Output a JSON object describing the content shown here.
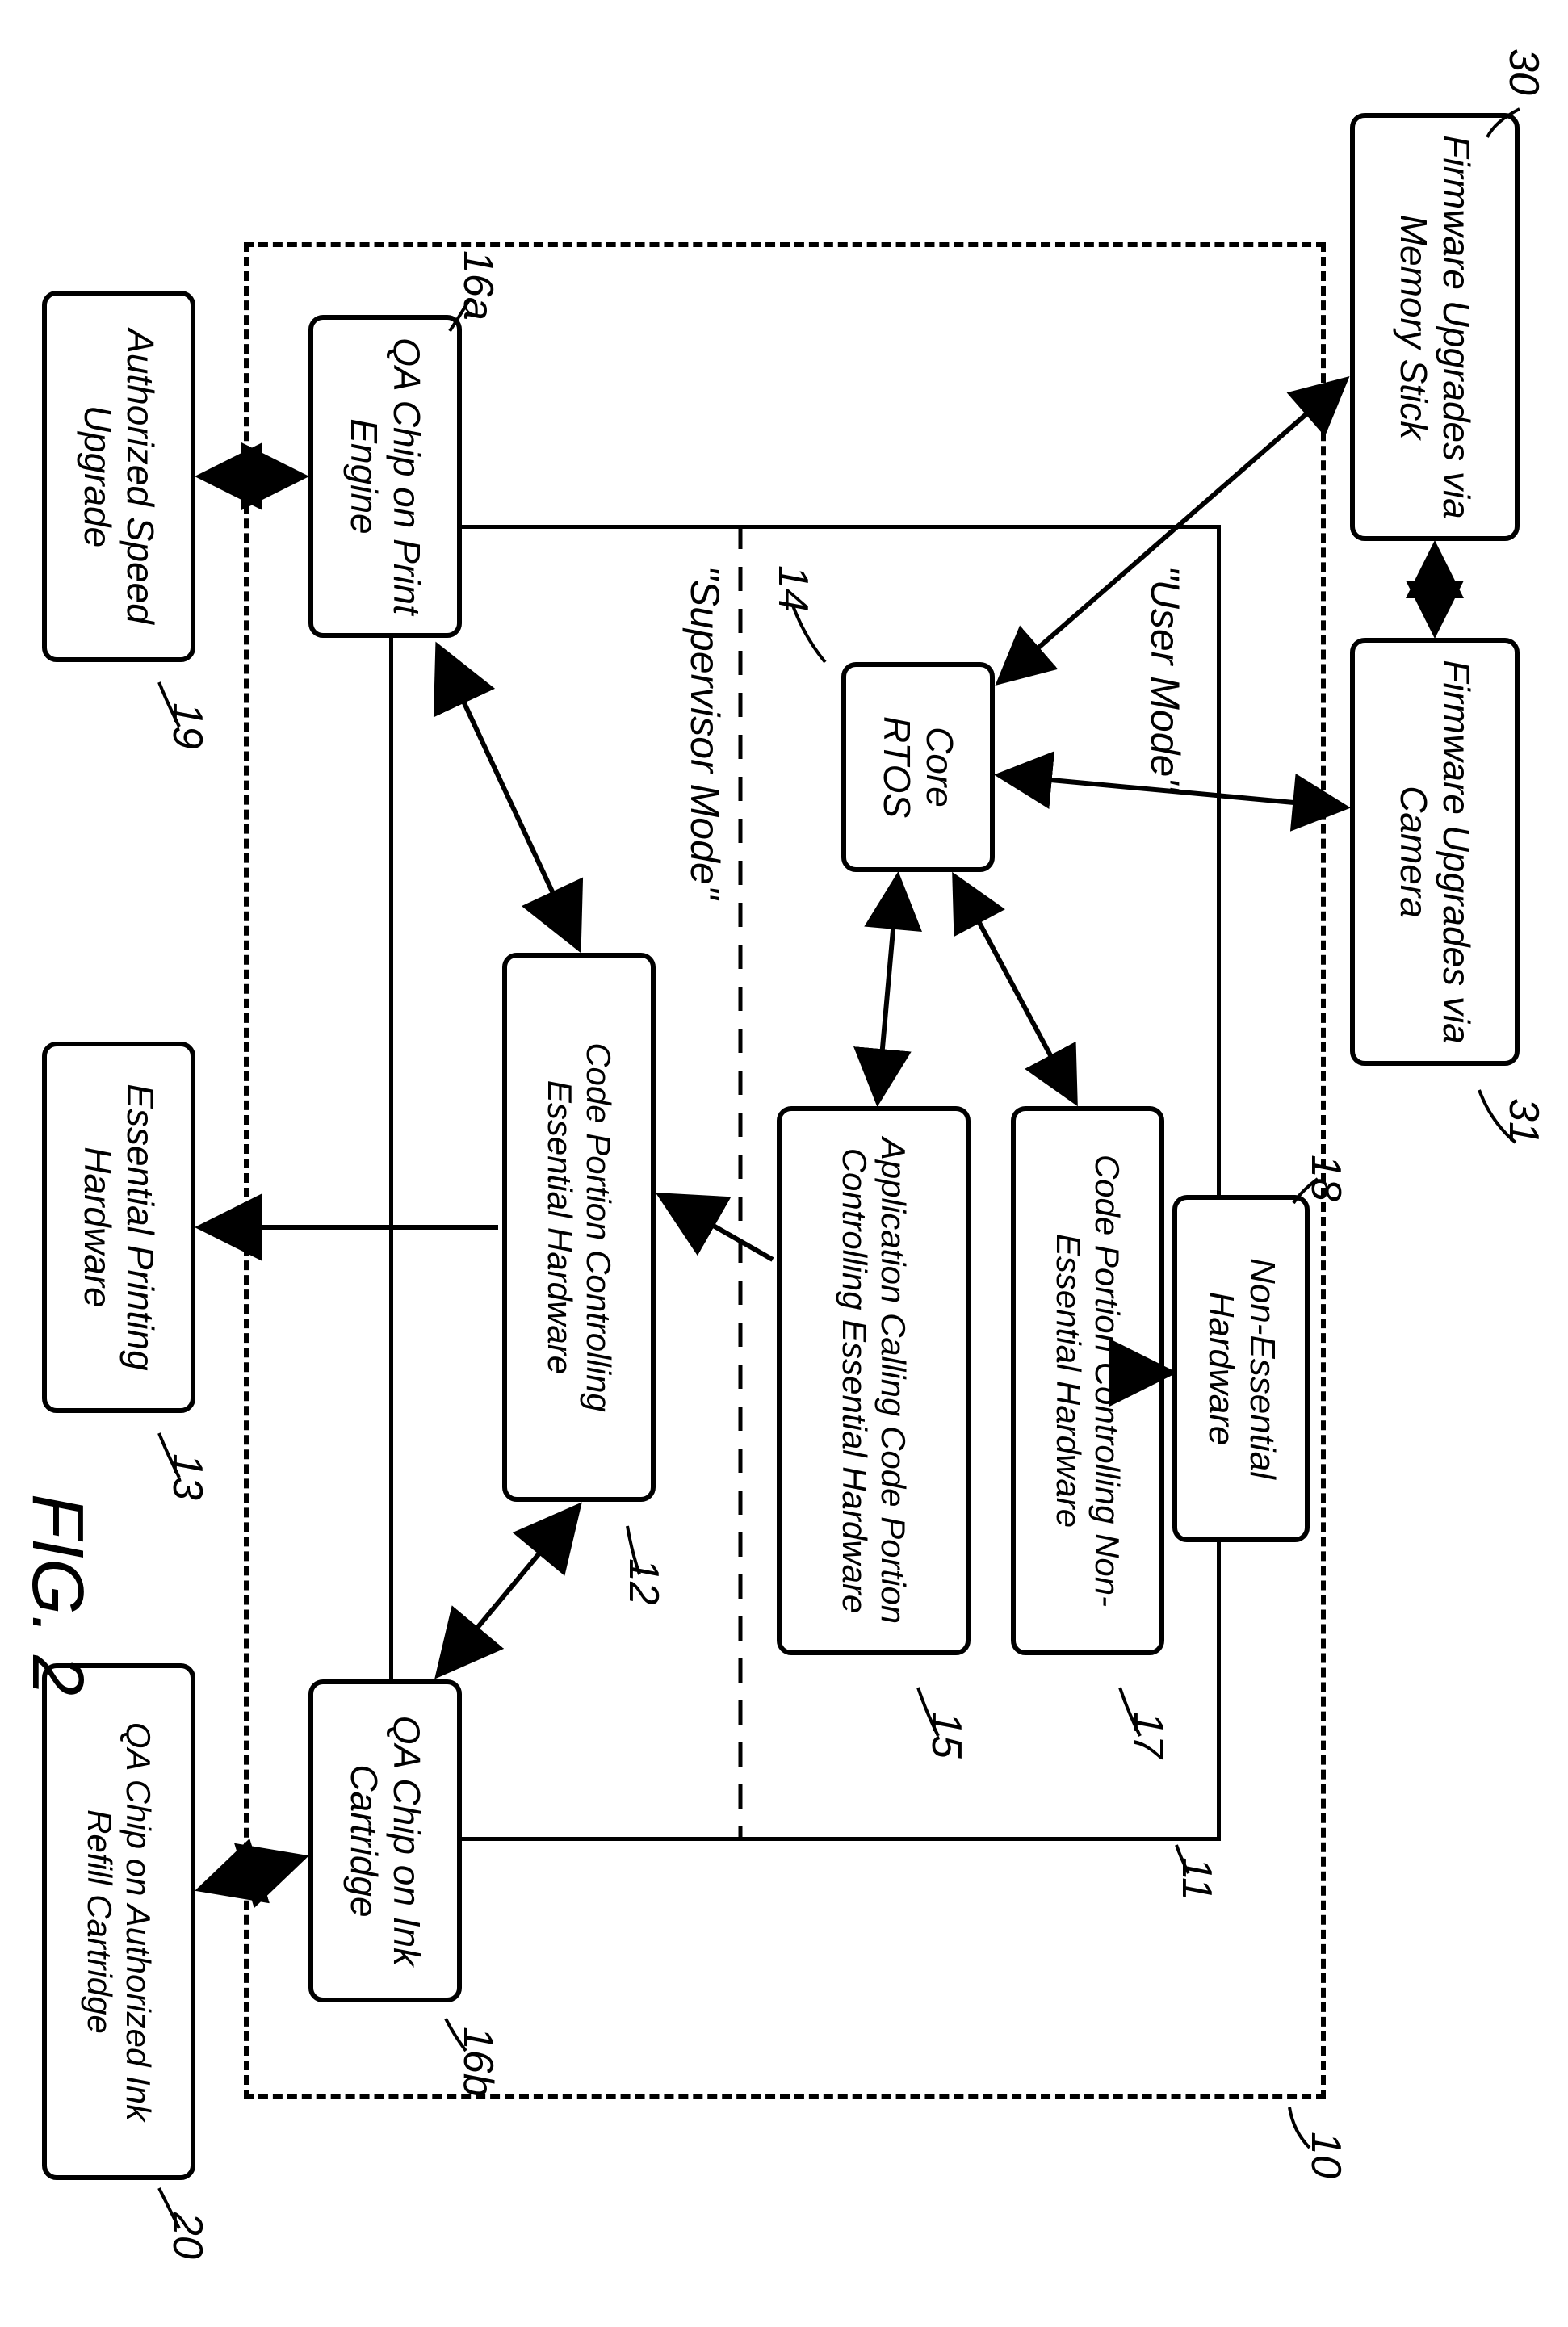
{
  "figure_label": "FIG. 2",
  "refs": {
    "r10": "10",
    "r11": "11",
    "r12": "12",
    "r13": "13",
    "r14": "14",
    "r15": "15",
    "r16a": "16a",
    "r16b": "16b",
    "r17": "17",
    "r18": "18",
    "r19": "19",
    "r20": "20",
    "r30": "30",
    "r31": "31"
  },
  "mode_labels": {
    "user": "\"User Mode\"",
    "supervisor": "\"Supervisor Mode\""
  },
  "boxes": {
    "firmware_mem": "Firmware Upgrades via Memory Stick",
    "firmware_cam": "Firmware Upgrades via Camera",
    "non_essential_hw": "Non-Essential Hardware",
    "core_rtos": "Core RTOS",
    "code_non_essential": "Code Portion Controlling Non-Essential Hardware",
    "app_calling": "Application Calling Code Portion Controlling Essential Hardware",
    "code_essential": "Code Portion Controlling Essential Hardware",
    "qa_print_engine": "QA Chip on Print Engine",
    "qa_ink_cartridge": "QA Chip on Ink Cartridge",
    "essential_printing_hw": "Essential Printing Hardware",
    "authorized_speed": "Authorized Speed Upgrade",
    "qa_authorized_refill": "QA Chip on Authorized Ink Refill Cartridge"
  },
  "chart_data": {
    "type": "diagram",
    "title": "FIG. 2",
    "nodes": [
      {
        "id": "30",
        "label": "Firmware Upgrades via Memory Stick",
        "external": true
      },
      {
        "id": "31",
        "label": "Firmware Upgrades via Camera",
        "external": true
      },
      {
        "id": "18",
        "label": "Non-Essential Hardware",
        "external": false,
        "inside_dashed_10": true
      },
      {
        "id": "14",
        "label": "Core RTOS",
        "region": "11-user-mode"
      },
      {
        "id": "17",
        "label": "Code Portion Controlling Non-Essential Hardware",
        "region": "11-user-mode"
      },
      {
        "id": "15",
        "label": "Application Calling Code Portion Controlling Essential Hardware",
        "region": "11-user-mode"
      },
      {
        "id": "12",
        "label": "Code Portion Controlling Essential Hardware",
        "region": "11-supervisor-mode"
      },
      {
        "id": "16a",
        "label": "QA Chip on Print Engine",
        "inside_dashed_10": true
      },
      {
        "id": "16b",
        "label": "QA Chip on Ink Cartridge",
        "inside_dashed_10": true
      },
      {
        "id": "13",
        "label": "Essential Printing Hardware",
        "external": true
      },
      {
        "id": "19",
        "label": "Authorized Speed Upgrade",
        "external": true
      },
      {
        "id": "20",
        "label": "QA Chip on Authorized Ink Refill Cartridge",
        "external": true
      }
    ],
    "regions": [
      {
        "id": "10",
        "style": "dashed-box"
      },
      {
        "id": "11",
        "style": "solid-box",
        "sub_regions": [
          "User Mode",
          "Supervisor Mode"
        ],
        "divider": "dashed-horizontal"
      }
    ],
    "edges": [
      {
        "from": "30",
        "to": "31",
        "bidirectional": true
      },
      {
        "from": "30",
        "to": "14",
        "bidirectional": true
      },
      {
        "from": "31",
        "to": "14",
        "bidirectional": true
      },
      {
        "from": "14",
        "to": "17",
        "bidirectional": true
      },
      {
        "from": "14",
        "to": "15",
        "bidirectional": true
      },
      {
        "from": "17",
        "to": "18",
        "bidirectional": false,
        "direction": "17->18"
      },
      {
        "from": "15",
        "to": "12",
        "bidirectional": false,
        "direction": "15->12"
      },
      {
        "from": "12",
        "to": "16a",
        "bidirectional": true
      },
      {
        "from": "12",
        "to": "16b",
        "bidirectional": true
      },
      {
        "from": "12",
        "to": "13",
        "bidirectional": false,
        "direction": "12->13"
      },
      {
        "from": "16a",
        "to": "19",
        "bidirectional": true
      },
      {
        "from": "16b",
        "to": "20",
        "bidirectional": true
      }
    ]
  }
}
